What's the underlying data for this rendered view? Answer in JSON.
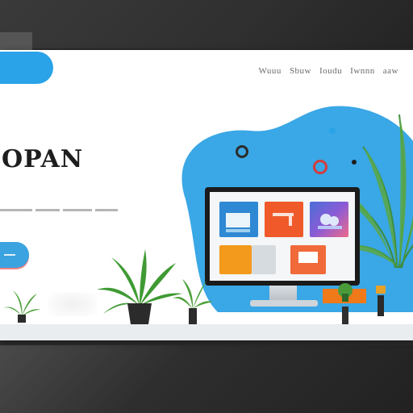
{
  "header": {
    "cta_label": "",
    "nav": [
      "Wuuu",
      "Sbuw",
      "Ioudu",
      "Iwnnn",
      "aaw"
    ]
  },
  "hero": {
    "title": "OPAN",
    "subtitle": "",
    "button_label": ""
  },
  "monitor": {
    "tiles": [
      {
        "name": "chart-tile",
        "color": "#2f88d3"
      },
      {
        "name": "bar-tile",
        "color": "#f05a2a"
      },
      {
        "name": "gradient-tile",
        "color": "#4a6fd8"
      },
      {
        "name": "orange-tile",
        "color": "#f39a1c"
      },
      {
        "name": "red-tile",
        "color": "#f06a3a"
      }
    ]
  },
  "colors": {
    "accent": "#2aa3e8",
    "blob": "#3aa7e6",
    "title": "#1e1e1e",
    "frame": "#2b2b2b"
  },
  "icons": [
    "plant-icon",
    "monitor-icon",
    "ring-icon",
    "pendant-lamp-icon"
  ]
}
